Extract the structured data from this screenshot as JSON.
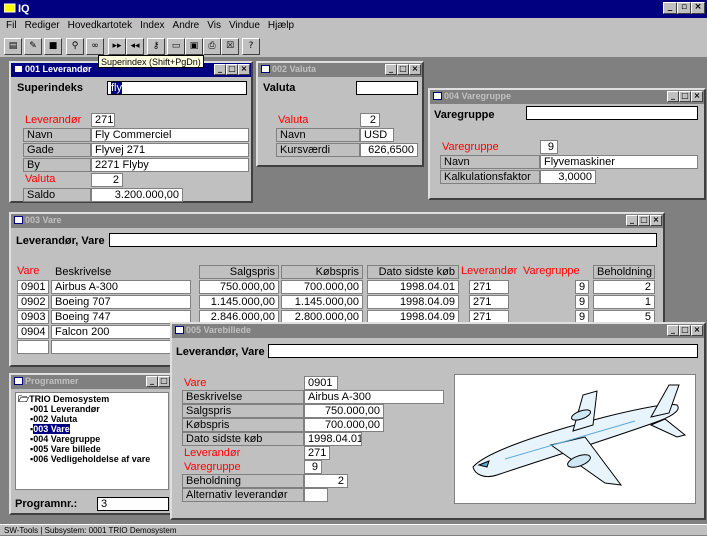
{
  "app": {
    "title": "IQ"
  },
  "menu": [
    "Fil",
    "Rediger",
    "Hovedkartotek",
    "Index",
    "Andre",
    "Vis",
    "Vindue",
    "Hjælp"
  ],
  "tooltip": "Superindex (Shift+PgDn)",
  "win001": {
    "title": "001 Leverandør",
    "super_label": "Superindeks",
    "super_value": "fly",
    "fields": [
      {
        "label": "Leverandør",
        "value": "271",
        "red": true
      },
      {
        "label": "Navn",
        "value": "Fly Commerciel",
        "red": false
      },
      {
        "label": "Gade",
        "value": "Flyvej 271",
        "red": false
      },
      {
        "label": "By",
        "value": "2271 Flyby",
        "red": false
      },
      {
        "label": "Valuta",
        "value": "2",
        "red": true
      },
      {
        "label": "Saldo",
        "value": "3.200.000,00",
        "red": false
      }
    ]
  },
  "win002": {
    "title": "002 Valuta",
    "head_label": "Valuta",
    "fields": [
      {
        "label": "Valuta",
        "value": "2"
      },
      {
        "label": "Navn",
        "value": "USD"
      },
      {
        "label": "Kursværdi",
        "value": "626,6500"
      }
    ]
  },
  "win004": {
    "title": "004 Varegruppe",
    "head_label": "Varegruppe",
    "fields": [
      {
        "label": "Varegruppe",
        "value": "9"
      },
      {
        "label": "Navn",
        "value": "Flyvemaskiner"
      },
      {
        "label": "Kalkulationsfaktor",
        "value": "3,0000"
      }
    ]
  },
  "win003": {
    "title": "003 Vare",
    "head_label": "Leverandør, Vare",
    "columns": [
      "Vare",
      "Beskrivelse",
      "Salgspris",
      "Købspris",
      "Dato sidste køb",
      "Leverandør",
      "Varegruppe",
      "Beholdning"
    ],
    "rows": [
      [
        "0901",
        "Airbus A-300",
        "750.000,00",
        "700.000,00",
        "1998.04.01",
        "271",
        "9",
        "2"
      ],
      [
        "0902",
        "Boeing 707",
        "1.145.000,00",
        "1.145.000,00",
        "1998.04.09",
        "271",
        "9",
        "1"
      ],
      [
        "0903",
        "Boeing 747",
        "2.846.000,00",
        "2.800.000,00",
        "1998.04.09",
        "271",
        "9",
        "5"
      ],
      [
        "0904",
        "Falcon 200",
        "",
        "",
        "",
        "",
        "",
        ""
      ]
    ]
  },
  "win005": {
    "title": "005 Varebillede",
    "head_label": "Leverandør, Vare",
    "fields": [
      {
        "label": "Vare",
        "value": "0901",
        "red": true
      },
      {
        "label": "Beskrivelse",
        "value": "Airbus A-300",
        "red": false
      },
      {
        "label": "Salgspris",
        "value": "750.000,00",
        "red": false
      },
      {
        "label": "Købspris",
        "value": "700.000,00",
        "red": false
      },
      {
        "label": "Dato sidste køb",
        "value": "1998.04.01",
        "red": false
      },
      {
        "label": "Leverandør",
        "value": "271",
        "red": true
      },
      {
        "label": "Varegruppe",
        "value": "9",
        "red": true
      },
      {
        "label": "Beholdning",
        "value": "2",
        "red": false
      },
      {
        "label": "Alternativ leverandør",
        "value": "",
        "red": false
      }
    ]
  },
  "programmer": {
    "title": "Programmer",
    "root": "TRIO Demosystem",
    "items": [
      "001 Leverandør",
      "002 Valuta",
      "003 Vare",
      "004 Varegruppe",
      "005 Vare billede",
      "006 Vedligeholdelse af vare"
    ],
    "selected_index": 2,
    "prog_label": "Programnr.:",
    "prog_value": "3"
  },
  "status": "SW-Tools | Subsystem: 0001 TRIO Demosystem",
  "colors": {
    "titlebar": "#000080",
    "label_red": "#ff0000",
    "face": "#c0c0c0",
    "desktop": "#808080"
  }
}
